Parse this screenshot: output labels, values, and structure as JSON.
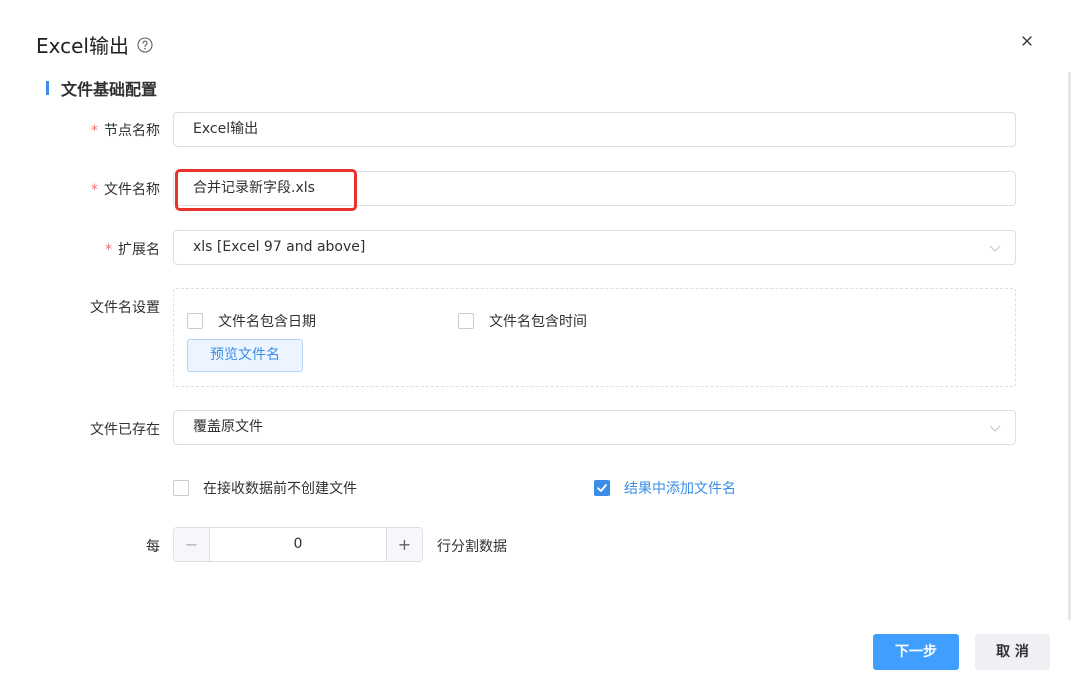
{
  "dialog": {
    "title": "Excel输出",
    "help_icon": "question-circle-icon",
    "close_icon": "close-icon"
  },
  "section": {
    "title": "文件基础配置"
  },
  "form": {
    "node_name": {
      "label": "节点名称",
      "required": "*",
      "value": "Excel输出"
    },
    "file_name": {
      "label": "文件名称",
      "required": "*",
      "value": "合并记录新字段.xls"
    },
    "extension": {
      "label": "扩展名",
      "required": "*",
      "value": "xls [Excel 97 and above]"
    },
    "filename_settings": {
      "label": "文件名设置",
      "include_date": {
        "label": "文件名包含日期",
        "checked": false
      },
      "include_time": {
        "label": "文件名包含时间",
        "checked": false
      },
      "preview_button": "预览文件名"
    },
    "file_exists": {
      "label": "文件已存在",
      "value": "覆盖原文件"
    },
    "no_create_before": {
      "label": "在接收数据前不创建文件",
      "checked": false
    },
    "add_filename_result": {
      "label": "结果中添加文件名",
      "checked": true
    },
    "split": {
      "prefix": "每",
      "value": "0",
      "minus": "−",
      "plus": "+",
      "suffix": "行分割数据"
    }
  },
  "footer": {
    "next_label": "下一步",
    "cancel_label": "取 消"
  },
  "colors": {
    "accent": "#409eff",
    "required": "#f56c6c",
    "highlight": "#e8332d"
  }
}
